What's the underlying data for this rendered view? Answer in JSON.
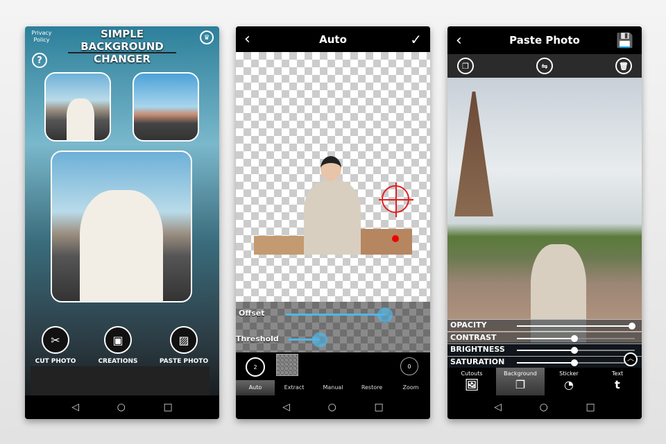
{
  "screen1": {
    "title_line1": "SIMPLE BACKGROUND",
    "title_line2": "CHANGER",
    "privacy": "Privacy Policy",
    "help": "?",
    "crown": "crown-icon",
    "tools": [
      {
        "label": "CUT PHOTO",
        "icon": "cut-photo-icon"
      },
      {
        "label": "CREATIONS",
        "icon": "gallery-icon"
      },
      {
        "label": "PASTE PHOTO",
        "icon": "paste-photo-icon"
      }
    ]
  },
  "screen2": {
    "title": "Auto",
    "back": "‹",
    "done": "✓",
    "offset_label": "Offset",
    "offset_value": 0.95,
    "threshold_label": "Threshold",
    "threshold_value": 0.3,
    "undo_count": "2",
    "redo_count": "0",
    "tabs": [
      "Auto",
      "Extract",
      "Manual",
      "Restore",
      "Zoom"
    ],
    "active_tab": "Auto",
    "slider_color": "#4fb6e8"
  },
  "screen3": {
    "title": "Paste Photo",
    "back": "‹",
    "adjustments": [
      {
        "label": "OPACITY",
        "value": 1.0
      },
      {
        "label": "CONTRAST",
        "value": 0.5
      },
      {
        "label": "BRIGHTNESS",
        "value": 0.5
      },
      {
        "label": "SATURATION",
        "value": 0.5
      }
    ],
    "tabs": [
      "Cutouts",
      "Background",
      "Sticker",
      "Text"
    ],
    "active_tab": "Background"
  },
  "navbar": {
    "back": "◁",
    "home": "○",
    "recent": "□"
  }
}
